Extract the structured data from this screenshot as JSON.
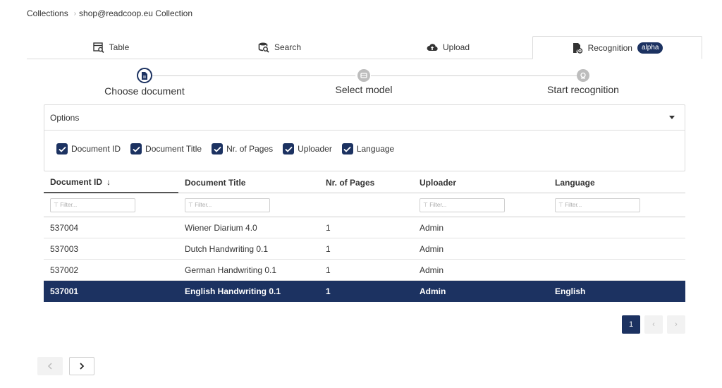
{
  "breadcrumb": {
    "root": "Collections",
    "current": "shop@readcoop.eu Collection"
  },
  "tabs": [
    {
      "label": "Table",
      "icon": "table-search-icon"
    },
    {
      "label": "Search",
      "icon": "search-db-icon"
    },
    {
      "label": "Upload",
      "icon": "cloud-upload-icon"
    },
    {
      "label": "Recognition",
      "icon": "document-recognition-icon",
      "badge": "alpha",
      "active": true
    }
  ],
  "stepper": {
    "steps": [
      {
        "label": "Choose document",
        "state": "current"
      },
      {
        "label": "Select model",
        "state": "pending"
      },
      {
        "label": "Start recognition",
        "state": "pending"
      }
    ]
  },
  "options": {
    "title": "Options",
    "checkboxes": [
      {
        "label": "Document ID",
        "checked": true
      },
      {
        "label": "Document Title",
        "checked": true
      },
      {
        "label": "Nr. of Pages",
        "checked": true
      },
      {
        "label": "Uploader",
        "checked": true
      },
      {
        "label": "Language",
        "checked": true
      }
    ]
  },
  "table": {
    "columns": [
      "Document ID",
      "Document Title",
      "Nr. of Pages",
      "Uploader",
      "Language"
    ],
    "filter_placeholder": "Filter...",
    "rows": [
      {
        "id": "537004",
        "title": "Wiener Diarium 4.0",
        "pages": "1",
        "uploader": "Admin",
        "language": ""
      },
      {
        "id": "537003",
        "title": "Dutch Handwriting 0.1",
        "pages": "1",
        "uploader": "Admin",
        "language": ""
      },
      {
        "id": "537002",
        "title": "German Handwriting 0.1",
        "pages": "1",
        "uploader": "Admin",
        "language": ""
      },
      {
        "id": "537001",
        "title": "English Handwriting 0.1",
        "pages": "1",
        "uploader": "Admin",
        "language": "English",
        "selected": true
      }
    ]
  },
  "pagination": {
    "current_page": "1"
  },
  "colors": {
    "accent": "#1c3261",
    "border": "#dcdcdc"
  }
}
